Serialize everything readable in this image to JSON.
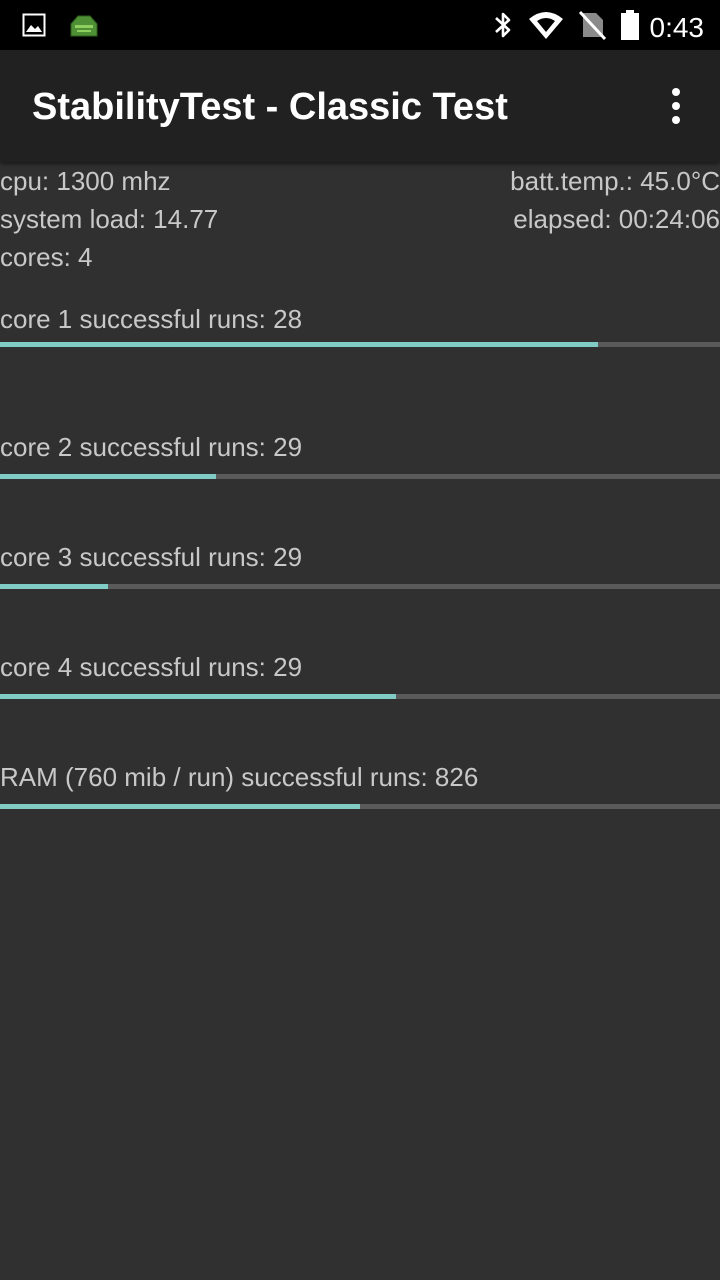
{
  "status_bar": {
    "time": "0:43",
    "left_icons": [
      "image-icon",
      "stability-test-app-icon"
    ],
    "right_icons": [
      "bluetooth-icon",
      "wifi-icon",
      "no-sim-icon",
      "battery-icon"
    ]
  },
  "app_bar": {
    "title": "StabilityTest - Classic Test",
    "menu_icon": "more-vert-icon"
  },
  "info": {
    "cpu": "cpu: 1300 mhz",
    "batt_temp": "batt.temp.: 45.0°C",
    "system_load": "system load: 14.77",
    "elapsed": "elapsed: 00:24:06",
    "cores": "cores: 4"
  },
  "tests": [
    {
      "label": "core 1 successful runs: 28",
      "progress": 0.83
    },
    {
      "label": "core 2 successful runs: 29",
      "progress": 0.3
    },
    {
      "label": "core 3 successful runs: 29",
      "progress": 0.15
    },
    {
      "label": "core 4 successful runs: 29",
      "progress": 0.55
    },
    {
      "label": "RAM (760 mib / run) successful runs: 826",
      "progress": 0.5
    }
  ],
  "colors": {
    "background": "#303030",
    "app_bar": "#212121",
    "progress_fill": "#80cbc4",
    "progress_track": "#5a5a5a",
    "text": "#c8c8c8"
  }
}
